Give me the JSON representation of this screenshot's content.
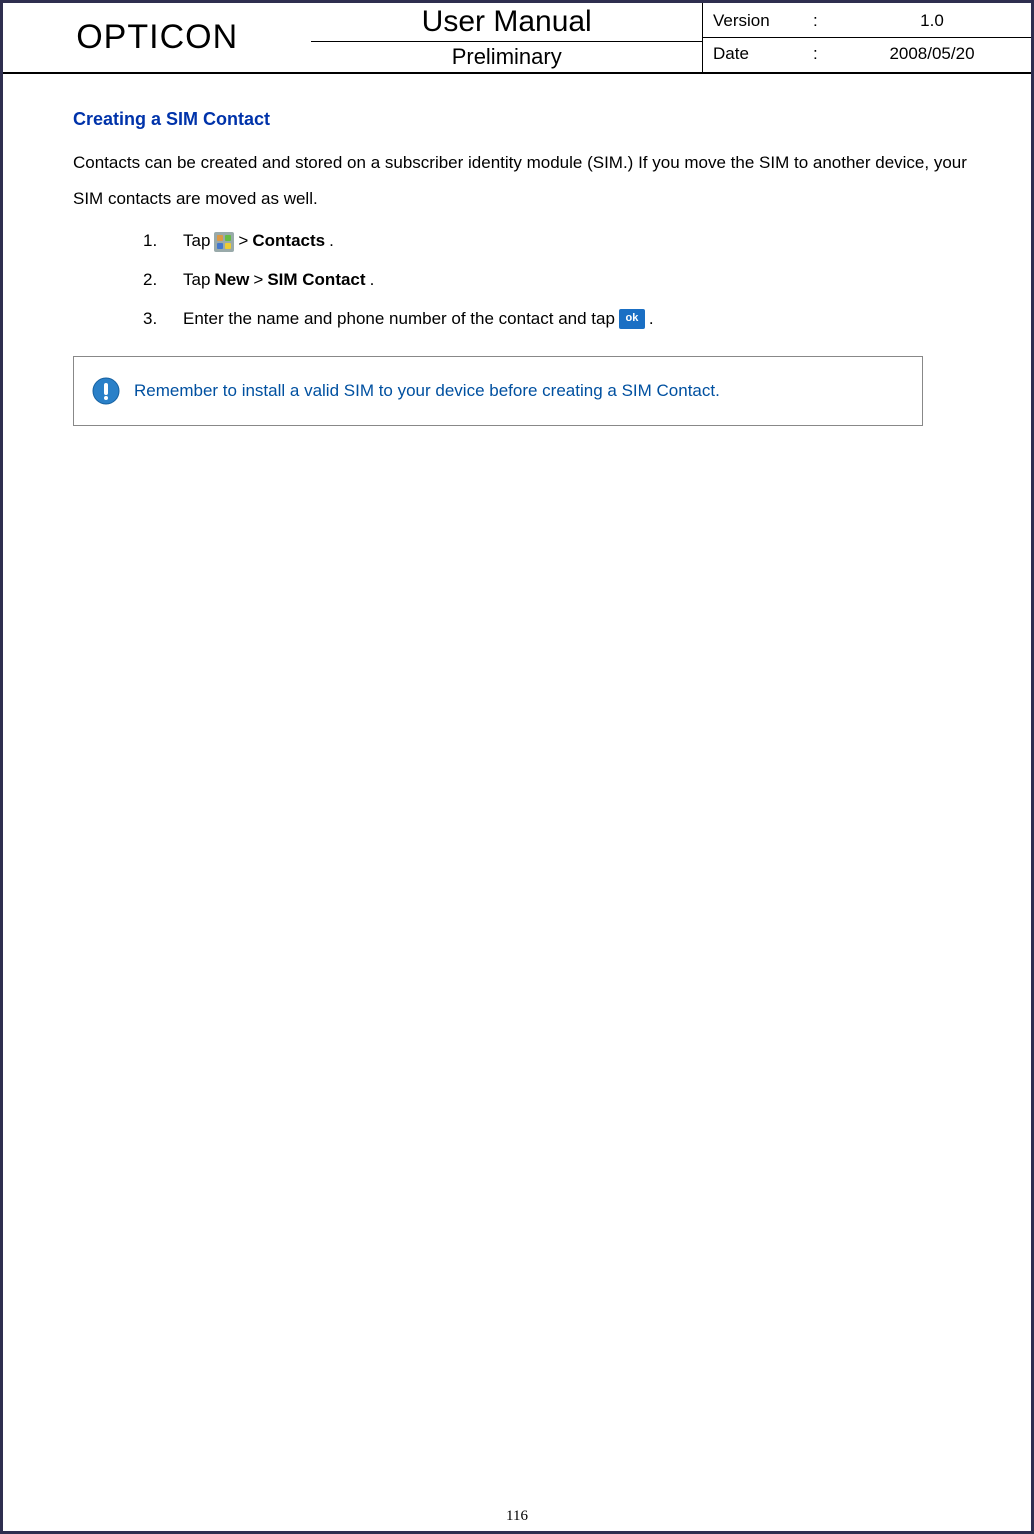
{
  "header": {
    "brand": "OPTICON",
    "title_main": "User Manual",
    "title_sub": "Preliminary",
    "version_label": "Version",
    "version_value": "1.0",
    "date_label": "Date",
    "date_value": "2008/05/20",
    "colon": ":"
  },
  "content": {
    "section_title": "Creating a SIM Contact",
    "intro": "Contacts can be created and stored on a subscriber identity module (SIM.) If you move the SIM to another device, your SIM contacts are moved as well.",
    "steps": [
      {
        "num": "1.",
        "pre": "Tap ",
        "gt1": " > ",
        "bold1": "Contacts",
        "post": "."
      },
      {
        "num": "2.",
        "pre": "Tap ",
        "bold1": "New",
        "mid": " > ",
        "bold2": "SIM Contact",
        "post": "."
      },
      {
        "num": "3.",
        "pre": "Enter the name and phone number of the contact and tap ",
        "post": " ."
      }
    ],
    "note": "Remember to install a valid SIM to your device before creating a SIM Contact."
  },
  "page_number": "116"
}
